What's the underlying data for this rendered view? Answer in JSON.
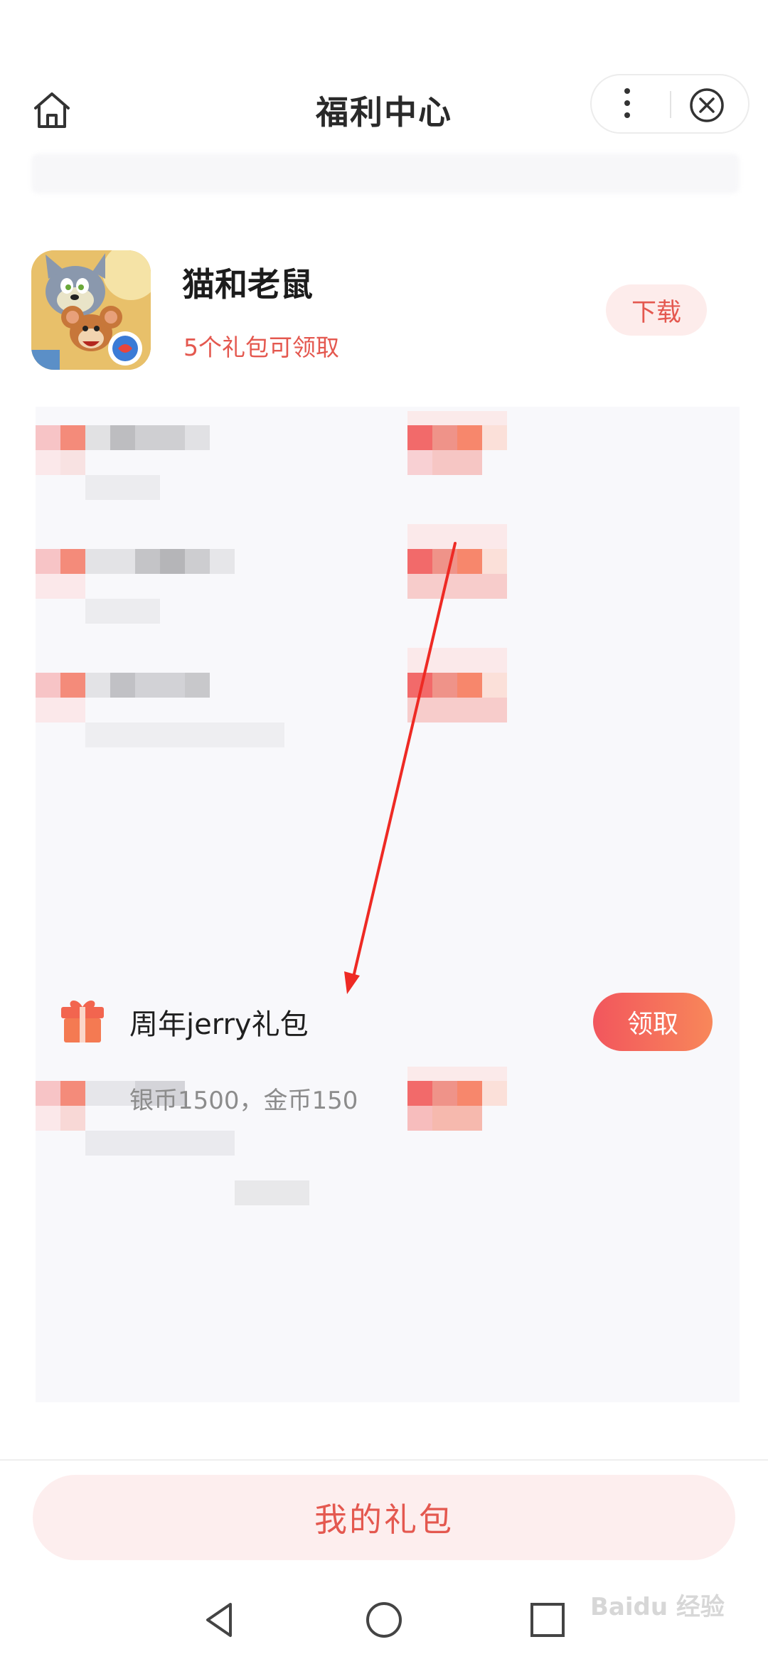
{
  "header": {
    "title": "福利中心",
    "home_icon": "home-icon",
    "more_icon": "more-vertical-icon",
    "close_icon": "close-circle-icon"
  },
  "game": {
    "name": "猫和老鼠",
    "gift_count_text": "5个礼包可领取",
    "download_label": "下载"
  },
  "gift": {
    "title": "周年jerry礼包",
    "description": "银币1500，金币150",
    "claim_label": "领取",
    "icon": "gift-icon"
  },
  "bottom": {
    "my_gifts_label": "我的礼包"
  },
  "nav": {
    "back_icon": "back-triangle-icon",
    "home_icon": "home-circle-icon",
    "recent_icon": "recent-square-icon"
  },
  "watermark": "Baidu 经验",
  "colors": {
    "accent": "#e4584f",
    "claim_gradient_start": "#f2565d",
    "claim_gradient_end": "#f8875a",
    "arrow": "#ee2a24"
  }
}
